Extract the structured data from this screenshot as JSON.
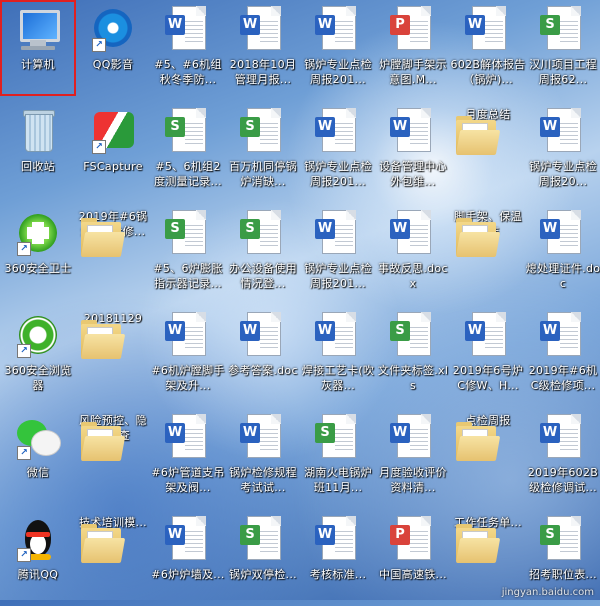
{
  "desktop": {
    "icons": [
      {
        "label": "计算机",
        "type": "computer",
        "selected": true
      },
      {
        "label": "QQ影音",
        "type": "qq-video",
        "shortcut": true
      },
      {
        "label": "#5、#6机组秋冬季防...",
        "type": "doc-w"
      },
      {
        "label": "2018年10月管理月报...",
        "type": "doc-w"
      },
      {
        "label": "锅炉专业点检周报201...",
        "type": "doc-w"
      },
      {
        "label": "炉膛脚手架示意图.M...",
        "type": "doc-p"
      },
      {
        "label": "602B解体报告（锅炉)...",
        "type": "doc-w"
      },
      {
        "label": "汉川项目工程周报62...",
        "type": "doc-s"
      },
      {
        "label": "回收站",
        "type": "recycle"
      },
      {
        "label": "FSCapture",
        "type": "fscap",
        "shortcut": true
      },
      {
        "label": "#5、6机组2度测量记录...",
        "type": "doc-s"
      },
      {
        "label": "百万机同停锅炉消缺...",
        "type": "doc-s"
      },
      {
        "label": "锅炉专业点检周报201...",
        "type": "doc-w"
      },
      {
        "label": "设备管理中心外包维...",
        "type": "doc-w"
      },
      {
        "label": "月度总结",
        "type": "folder"
      },
      {
        "label": "锅炉专业点检周报20...",
        "type": "doc-w"
      },
      {
        "label": "360安全卫士",
        "type": "s360",
        "shortcut": true
      },
      {
        "label": "2019年#6锅炉C级检修...",
        "type": "folder"
      },
      {
        "label": "#5、6炉膨胀指示器记录...",
        "type": "doc-s"
      },
      {
        "label": "办公设备使用情况登...",
        "type": "doc-s"
      },
      {
        "label": "锅炉专业点检周报201...",
        "type": "doc-w"
      },
      {
        "label": "事故反思.docx",
        "type": "doc-w"
      },
      {
        "label": "脚手架、保温工作",
        "type": "folder"
      },
      {
        "label": "熄处理证件.doc",
        "type": "doc-w"
      },
      {
        "label": "360安全浏览器",
        "type": "ie",
        "shortcut": true
      },
      {
        "label": "20181129",
        "type": "folder"
      },
      {
        "label": "#6机炉膛脚手架及升...",
        "type": "doc-w"
      },
      {
        "label": "参考答案.doc",
        "type": "doc-w"
      },
      {
        "label": "焊接工艺卡(吹灰器...",
        "type": "doc-w"
      },
      {
        "label": "文件夹标签.xls",
        "type": "doc-s"
      },
      {
        "label": "2019年6号炉C修W、H...",
        "type": "doc-w"
      },
      {
        "label": "2019年#6机C级检修项...",
        "type": "doc-w"
      },
      {
        "label": "微信",
        "type": "wechat",
        "shortcut": true
      },
      {
        "label": "风险预控、隐患排查",
        "type": "folder"
      },
      {
        "label": "#6炉管道支吊架及阀...",
        "type": "doc-w"
      },
      {
        "label": "锅炉检修规程考试试...",
        "type": "doc-w"
      },
      {
        "label": "湖南火电锅炉班11月...",
        "type": "doc-s"
      },
      {
        "label": "月度验收评价资料清...",
        "type": "doc-w"
      },
      {
        "label": "点检周报",
        "type": "folder"
      },
      {
        "label": "2019年602B级检修调试...",
        "type": "doc-w"
      },
      {
        "label": "腾讯QQ",
        "type": "qq",
        "shortcut": true
      },
      {
        "label": "技术培训模...",
        "type": "folder"
      },
      {
        "label": "#6炉炉墙及...",
        "type": "doc-w"
      },
      {
        "label": "锅炉双停检...",
        "type": "doc-s"
      },
      {
        "label": "考核标准...",
        "type": "doc-w"
      },
      {
        "label": "中国高速铁...",
        "type": "doc-p"
      },
      {
        "label": "工作任务单...",
        "type": "folder"
      },
      {
        "label": "招考职位表...",
        "type": "doc-s"
      }
    ]
  },
  "badges": {
    "doc-w": "W",
    "doc-s": "S",
    "doc-p": "P"
  },
  "watermark": "jingyan.baidu.com"
}
